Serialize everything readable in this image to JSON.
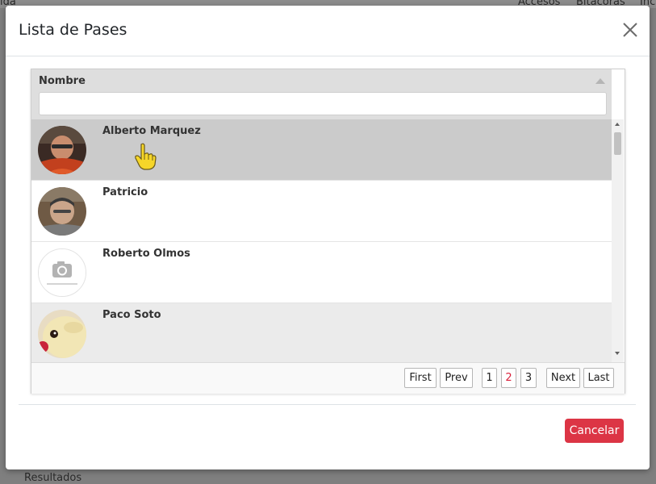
{
  "background": {
    "nav_items": [
      "ıda",
      "Accesos",
      "Bitácoras",
      "Inc"
    ],
    "bottom_text": "Resultados"
  },
  "modal": {
    "title": "Lista de Pases",
    "close_icon": "close-icon"
  },
  "grid": {
    "column_header": "Nombre",
    "filter_value": "",
    "rows": [
      {
        "name": "Alberto Marquez",
        "state": "selected",
        "avatar": "photo"
      },
      {
        "name": "Patricio",
        "state": "normal",
        "avatar": "photo"
      },
      {
        "name": "Roberto Olmos",
        "state": "normal",
        "avatar": "camera-placeholder-icon"
      },
      {
        "name": "Paco Soto",
        "state": "alternate",
        "avatar": "photo"
      }
    ]
  },
  "pager": {
    "first": "First",
    "prev": "Prev",
    "pages": [
      "1",
      "2",
      "3"
    ],
    "current_page": "2",
    "next": "Next",
    "last": "Last"
  },
  "footer": {
    "cancel_label": "Cancelar"
  },
  "colors": {
    "danger": "#dc3545",
    "selected_row": "#cbcbcb",
    "header_bg": "#dedede",
    "current_page": "#d9213b"
  }
}
